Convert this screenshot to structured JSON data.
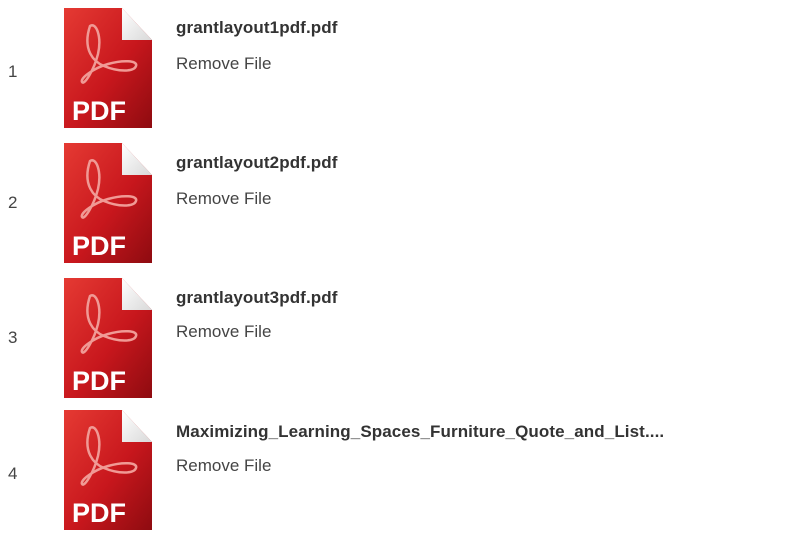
{
  "files": [
    {
      "index": "1",
      "name": "grantlayout1pdf.pdf",
      "remove_label": "Remove File",
      "icon": "pdf-file-icon",
      "icon_label": "PDF"
    },
    {
      "index": "2",
      "name": "grantlayout2pdf.pdf",
      "remove_label": "Remove File",
      "icon": "pdf-file-icon",
      "icon_label": "PDF"
    },
    {
      "index": "3",
      "name": "grantlayout3pdf.pdf",
      "remove_label": "Remove File",
      "icon": "pdf-file-icon",
      "icon_label": "PDF"
    },
    {
      "index": "4",
      "name": "Maximizing_Learning_Spaces_Furniture_Quote_and_List....",
      "remove_label": "Remove File",
      "icon": "pdf-file-icon",
      "icon_label": "PDF"
    }
  ],
  "colors": {
    "pdf_red": "#c8171d",
    "pdf_dark_red": "#8e0b10",
    "text": "#333333"
  }
}
